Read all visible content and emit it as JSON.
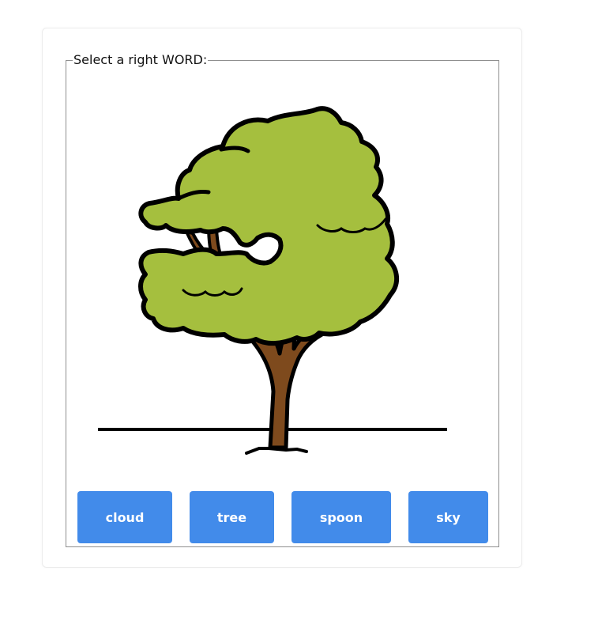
{
  "prompt": {
    "legend": "Select a right WORD:"
  },
  "picture": {
    "icon": "tree-icon",
    "colors": {
      "foliage": "#a5bf3e",
      "trunk": "#7e4a1d",
      "outline": "#000000"
    }
  },
  "choices": [
    {
      "label": "cloud"
    },
    {
      "label": "tree"
    },
    {
      "label": "spoon"
    },
    {
      "label": "sky"
    }
  ],
  "colors": {
    "button": "#428bea",
    "button_text": "#ffffff",
    "border": "#8f8f8f"
  }
}
